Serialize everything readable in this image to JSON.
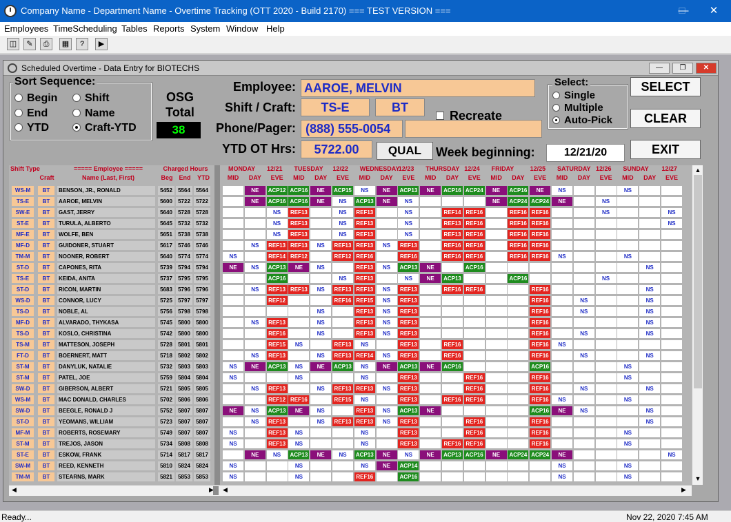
{
  "window": {
    "title": "Company Name - Department Name - Overtime Tracking (OTT 2020 - Build 2170)  === TEST VERSION ==="
  },
  "menu": [
    "Employees",
    "TimeScheduling",
    "Tables",
    "Reports",
    "System",
    "Window",
    "Help"
  ],
  "child": {
    "title": "Scheduled Overtime - Data Entry for BIOTECHS"
  },
  "sort": {
    "legend": "Sort Sequence:",
    "options": [
      "Begin",
      "Shift",
      "End",
      "Name",
      "YTD",
      "Craft-YTD"
    ],
    "selected": "Craft-YTD"
  },
  "osg": {
    "label": "OSG Total",
    "value": "38"
  },
  "employee": {
    "label": "Employee:",
    "name": "AAROE, MELVIN",
    "shift_label": "Shift / Craft:",
    "shift": "TS-E",
    "craft": "BT",
    "recreate_label": "Recreate",
    "phone_label": "Phone/Pager:",
    "phone": "(888) 555-0054",
    "pager": "",
    "ytd_label": "YTD OT Hrs:",
    "ytd": "5722.00",
    "qual_label": "QUAL",
    "week_label": "Week beginning:",
    "week": "12/21/20"
  },
  "select": {
    "legend": "Select:",
    "options": [
      "Single",
      "Multiple",
      "Auto-Pick"
    ],
    "selected": "Auto-Pick"
  },
  "buttons": {
    "select": "SELECT",
    "clear": "CLEAR",
    "exit": "EXIT"
  },
  "grid": {
    "headers": {
      "shift_type": "Shift Type",
      "craft": "Craft",
      "employee": "===== Employee =====",
      "employee_sub": "Name (Last, First)",
      "charged": "Charged Hours",
      "beg": "Beg",
      "end": "End",
      "ytd": "YTD"
    },
    "days": [
      {
        "name": "MONDAY",
        "date": "12/21"
      },
      {
        "name": "TUESDAY",
        "date": "12/22"
      },
      {
        "name": "WEDNESDAY",
        "date": "12/23"
      },
      {
        "name": "THURSDAY",
        "date": "12/24"
      },
      {
        "name": "FRIDAY",
        "date": "12/25"
      },
      {
        "name": "SATURDAY",
        "date": "12/26"
      },
      {
        "name": "SUNDAY",
        "date": "12/27"
      }
    ],
    "sub_cols": [
      "MID",
      "DAY",
      "EVE"
    ],
    "rows": [
      {
        "shift": "WS-M",
        "craft": "BT",
        "name": "BENSON, JR., RONALD",
        "beg": "5452",
        "end": "5564",
        "ytd": "5564",
        "cells": [
          "",
          "NE",
          "ACP12",
          "ACP16",
          "NE",
          "ACP15",
          "NS",
          "NE",
          "ACP13",
          "NE",
          "ACP16",
          "ACP24",
          "NE",
          "ACP16",
          "NE",
          "NS",
          "",
          "",
          "NS",
          "",
          ""
        ]
      },
      {
        "shift": "TS-E",
        "craft": "BT",
        "name": "AAROE, MELVIN",
        "beg": "5600",
        "end": "5722",
        "ytd": "5722",
        "cells": [
          "",
          "NE",
          "ACP16",
          "ACP16",
          "NE",
          "NS",
          "ACP13",
          "NE",
          "NS",
          "",
          "",
          "",
          "NE",
          "ACP24",
          "ACP24",
          "NE",
          "",
          "NS",
          "",
          "",
          ""
        ]
      },
      {
        "shift": "SW-E",
        "craft": "BT",
        "name": "GAST, JERRY",
        "beg": "5640",
        "end": "5728",
        "ytd": "5728",
        "cells": [
          "",
          "",
          "NS",
          "REF13",
          "",
          "NS",
          "REF13",
          "",
          "NS",
          "",
          "REF14",
          "REF16",
          "",
          "REF16",
          "REF16",
          "",
          "",
          "NS",
          "",
          "",
          "NS"
        ]
      },
      {
        "shift": "ST-E",
        "craft": "BT",
        "name": "TURULA, ALBERTO",
        "beg": "5645",
        "end": "5732",
        "ytd": "5732",
        "cells": [
          "",
          "",
          "NS",
          "REF13",
          "",
          "NS",
          "REF13",
          "",
          "NS",
          "",
          "REF13",
          "REF16",
          "",
          "REF16",
          "REF16",
          "",
          "",
          "",
          "",
          "",
          "NS"
        ]
      },
      {
        "shift": "MF-E",
        "craft": "BT",
        "name": "WOLFE, BEN",
        "beg": "5651",
        "end": "5738",
        "ytd": "5738",
        "cells": [
          "",
          "",
          "NS",
          "REF13",
          "",
          "NS",
          "REF13",
          "",
          "NS",
          "",
          "REF13",
          "REF16",
          "",
          "REF16",
          "REF16",
          "",
          "",
          "",
          "",
          "",
          ""
        ]
      },
      {
        "shift": "MF-D",
        "craft": "BT",
        "name": "GUIDONER, STUART",
        "beg": "5617",
        "end": "5746",
        "ytd": "5746",
        "cells": [
          "",
          "NS",
          "REF13",
          "REF13",
          "NS",
          "REF13",
          "REF13",
          "NS",
          "REF13",
          "",
          "REF16",
          "REF16",
          "",
          "REF16",
          "REF16",
          "",
          "",
          "",
          "",
          "",
          ""
        ]
      },
      {
        "shift": "TM-M",
        "craft": "BT",
        "name": "NOONER, ROBERT",
        "beg": "5640",
        "end": "5774",
        "ytd": "5774",
        "cells": [
          "NS",
          "",
          "REF14",
          "REF12",
          "",
          "REF12",
          "REF16",
          "",
          "REF16",
          "",
          "REF16",
          "REF16",
          "",
          "REF16",
          "REF16",
          "NS",
          "",
          "",
          "NS",
          "",
          ""
        ]
      },
      {
        "shift": "ST-D",
        "craft": "BT",
        "name": "CAPONES, RITA",
        "beg": "5739",
        "end": "5794",
        "ytd": "5794",
        "cells": [
          "NE",
          "NS",
          "ACP13",
          "NE",
          "NS",
          "",
          "REF13",
          "NS",
          "ACP13",
          "NE",
          "",
          "ACP16",
          "",
          "",
          "",
          "",
          "",
          "",
          "",
          "NS",
          ""
        ]
      },
      {
        "shift": "TS-E",
        "craft": "BT",
        "name": "KEIDA, ANITA",
        "beg": "5737",
        "end": "5795",
        "ytd": "5795",
        "cells": [
          "",
          "",
          "ACP16",
          "",
          "",
          "NS",
          "REF13",
          "",
          "NS",
          "NE",
          "ACP13",
          "",
          "",
          "ACP16",
          "",
          "",
          "",
          "NS",
          "",
          "",
          ""
        ]
      },
      {
        "shift": "ST-D",
        "craft": "BT",
        "name": "RICON, MARTIN",
        "beg": "5683",
        "end": "5796",
        "ytd": "5796",
        "cells": [
          "",
          "NS",
          "REF13",
          "REF13",
          "NS",
          "REF13",
          "REF13",
          "NS",
          "REF13",
          "",
          "REF16",
          "REF16",
          "",
          "",
          "REF16",
          "",
          "",
          "",
          "",
          "NS",
          ""
        ]
      },
      {
        "shift": "WS-D",
        "craft": "BT",
        "name": "CONNOR, LUCY",
        "beg": "5725",
        "end": "5797",
        "ytd": "5797",
        "cells": [
          "",
          "",
          "REF12",
          "",
          "",
          "REF16",
          "REF15",
          "NS",
          "REF13",
          "",
          "",
          "",
          "",
          "",
          "REF16",
          "",
          "NS",
          "",
          "",
          "NS",
          ""
        ]
      },
      {
        "shift": "TS-D",
        "craft": "BT",
        "name": "NOBLE, AL",
        "beg": "5756",
        "end": "5798",
        "ytd": "5798",
        "cells": [
          "",
          "",
          "",
          "",
          "NS",
          "",
          "REF13",
          "NS",
          "REF13",
          "",
          "",
          "",
          "",
          "",
          "REF16",
          "",
          "NS",
          "",
          "",
          "NS",
          ""
        ]
      },
      {
        "shift": "MF-D",
        "craft": "BT",
        "name": "ALVARADO, THYKASA",
        "beg": "5745",
        "end": "5800",
        "ytd": "5800",
        "cells": [
          "",
          "NS",
          "REF13",
          "",
          "NS",
          "",
          "REF13",
          "NS",
          "REF13",
          "",
          "",
          "",
          "",
          "",
          "REF16",
          "",
          "",
          "",
          "",
          "NS",
          ""
        ]
      },
      {
        "shift": "TS-D",
        "craft": "BT",
        "name": "KOSLO, CHRISTINA",
        "beg": "5742",
        "end": "5800",
        "ytd": "5800",
        "cells": [
          "",
          "",
          "REF16",
          "",
          "NS",
          "",
          "REF13",
          "NS",
          "REF13",
          "",
          "",
          "",
          "",
          "",
          "REF16",
          "",
          "NS",
          "",
          "",
          "NS",
          ""
        ]
      },
      {
        "shift": "TS-M",
        "craft": "BT",
        "name": "MATTESON, JOSEPH",
        "beg": "5728",
        "end": "5801",
        "ytd": "5801",
        "cells": [
          "",
          "",
          "REF15",
          "NS",
          "",
          "REF13",
          "NS",
          "",
          "REF13",
          "",
          "REF16",
          "",
          "",
          "",
          "REF16",
          "NS",
          "",
          "",
          "",
          "",
          ""
        ]
      },
      {
        "shift": "FT-D",
        "craft": "BT",
        "name": "BOERNERT, MATT",
        "beg": "5718",
        "end": "5802",
        "ytd": "5802",
        "cells": [
          "",
          "NS",
          "REF13",
          "",
          "NS",
          "REF13",
          "REF14",
          "NS",
          "REF13",
          "",
          "REF16",
          "",
          "",
          "",
          "REF16",
          "",
          "NS",
          "",
          "",
          "NS",
          ""
        ]
      },
      {
        "shift": "ST-M",
        "craft": "BT",
        "name": "DANYLUK, NATALIE",
        "beg": "5732",
        "end": "5803",
        "ytd": "5803",
        "cells": [
          "NS",
          "NE",
          "ACP13",
          "NS",
          "NE",
          "ACP13",
          "NS",
          "NE",
          "ACP13",
          "NE",
          "ACP16",
          "",
          "",
          "",
          "ACP16",
          "",
          "",
          "",
          "NS",
          "",
          ""
        ]
      },
      {
        "shift": "ST-M",
        "craft": "BT",
        "name": "PATEL, JOE",
        "beg": "5759",
        "end": "5804",
        "ytd": "5804",
        "cells": [
          "NS",
          "",
          "",
          "NS",
          "",
          "",
          "NS",
          "",
          "REF13",
          "",
          "",
          "REF16",
          "",
          "",
          "REF16",
          "",
          "",
          "",
          "NS",
          "",
          ""
        ]
      },
      {
        "shift": "SW-D",
        "craft": "BT",
        "name": "GIBERSON, ALBERT",
        "beg": "5721",
        "end": "5805",
        "ytd": "5805",
        "cells": [
          "",
          "NS",
          "REF13",
          "",
          "NS",
          "REF13",
          "REF13",
          "NS",
          "REF13",
          "",
          "",
          "REF16",
          "",
          "",
          "REF16",
          "",
          "NS",
          "",
          "",
          "NS",
          ""
        ]
      },
      {
        "shift": "WS-M",
        "craft": "BT",
        "name": "MAC DONALD, CHARLES",
        "beg": "5702",
        "end": "5806",
        "ytd": "5806",
        "cells": [
          "",
          "",
          "REF12",
          "REF16",
          "",
          "REF15",
          "NS",
          "",
          "REF13",
          "",
          "REF16",
          "REF16",
          "",
          "",
          "REF16",
          "NS",
          "",
          "",
          "NS",
          "",
          ""
        ]
      },
      {
        "shift": "SW-D",
        "craft": "BT",
        "name": "BEEGLE, RONALD J",
        "beg": "5752",
        "end": "5807",
        "ytd": "5807",
        "cells": [
          "NE",
          "NS",
          "ACP13",
          "NE",
          "NS",
          "",
          "REF13",
          "NS",
          "ACP13",
          "NE",
          "",
          "",
          "",
          "",
          "ACP16",
          "NE",
          "NS",
          "",
          "",
          "NS",
          ""
        ]
      },
      {
        "shift": "ST-D",
        "craft": "BT",
        "name": "YEOMANS, WILLIAM",
        "beg": "5723",
        "end": "5807",
        "ytd": "5807",
        "cells": [
          "",
          "NS",
          "REF13",
          "",
          "NS",
          "REF13",
          "REF13",
          "NS",
          "REF13",
          "",
          "",
          "REF16",
          "",
          "",
          "REF16",
          "",
          "",
          "",
          "",
          "NS",
          ""
        ]
      },
      {
        "shift": "MF-M",
        "craft": "BT",
        "name": "ROBERTS, ROSEMARY",
        "beg": "5749",
        "end": "5807",
        "ytd": "5807",
        "cells": [
          "NS",
          "",
          "REF13",
          "NS",
          "",
          "",
          "NS",
          "",
          "REF13",
          "",
          "",
          "REF16",
          "",
          "",
          "REF16",
          "",
          "",
          "",
          "NS",
          "",
          ""
        ]
      },
      {
        "shift": "ST-M",
        "craft": "BT",
        "name": "TREJOS, JASON",
        "beg": "5734",
        "end": "5808",
        "ytd": "5808",
        "cells": [
          "NS",
          "",
          "REF13",
          "NS",
          "",
          "",
          "NS",
          "",
          "REF13",
          "",
          "REF16",
          "REF16",
          "",
          "",
          "REF16",
          "",
          "",
          "",
          "NS",
          "",
          ""
        ]
      },
      {
        "shift": "ST-E",
        "craft": "BT",
        "name": "ESKOW, FRANK",
        "beg": "5714",
        "end": "5817",
        "ytd": "5817",
        "cells": [
          "",
          "NE",
          "NS",
          "ACP13",
          "NE",
          "NS",
          "ACP13",
          "NE",
          "NS",
          "NE",
          "ACP13",
          "ACP16",
          "NE",
          "ACP24",
          "ACP24",
          "NE",
          "",
          "",
          "",
          "",
          "NS"
        ]
      },
      {
        "shift": "SW-M",
        "craft": "BT",
        "name": "REED, KENNETH",
        "beg": "5810",
        "end": "5824",
        "ytd": "5824",
        "cells": [
          "NS",
          "",
          "",
          "NS",
          "",
          "",
          "NS",
          "NE",
          "ACP14",
          "",
          "",
          "",
          "",
          "",
          "",
          "NS",
          "",
          "",
          "NS",
          "",
          ""
        ]
      },
      {
        "shift": "TM-M",
        "craft": "BT",
        "name": "STEARNS, MARK",
        "beg": "5821",
        "end": "5853",
        "ytd": "5853",
        "cells": [
          "NS",
          "",
          "",
          "NS",
          "",
          "",
          "REF16",
          "",
          "ACP16",
          "",
          "",
          "",
          "",
          "",
          "",
          "NS",
          "",
          "",
          "NS",
          "",
          ""
        ]
      }
    ]
  },
  "status": {
    "text": "Ready...",
    "datetime": "Nov 22, 2020   7:45 AM"
  }
}
